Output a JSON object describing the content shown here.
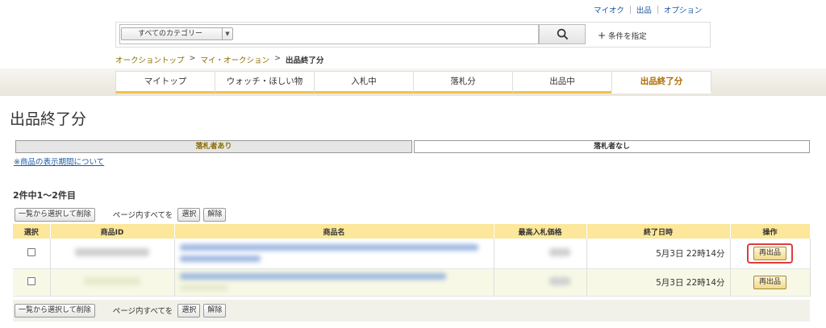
{
  "toplinks": [
    "マイオク",
    "出品",
    "オプション"
  ],
  "search": {
    "category": "すべてのカテゴリー",
    "value": "",
    "condition_label": "条件を指定"
  },
  "breadcrumb": [
    "オークショントップ",
    "マイ・オークション",
    "出品終了分"
  ],
  "tabs": [
    "マイトップ",
    "ウォッチ・ほしい物",
    "入札中",
    "落札分",
    "出品中",
    "出品終了分"
  ],
  "page_title": "出品終了分",
  "segments": [
    "落札者あり",
    "落札者なし"
  ],
  "period_link": "※商品の表示期間について",
  "count_text": "2件中1〜2件目",
  "actions": {
    "bulk_delete": "一覧から選択して削除",
    "page_all": "ページ内すべてを",
    "select": "選択",
    "clear": "解除"
  },
  "table": {
    "headers": [
      "選択",
      "商品ID",
      "商品名",
      "最高入札価格",
      "終了日時",
      "操作"
    ],
    "rows": [
      {
        "end_time": "5月3日 22時14分",
        "action": "再出品"
      },
      {
        "end_time": "5月3日 22時14分",
        "action": "再出品"
      }
    ]
  },
  "colors": {
    "accent": "#f2c24c",
    "header_bg": "#fce79a",
    "highlight": "#e03c3c"
  }
}
